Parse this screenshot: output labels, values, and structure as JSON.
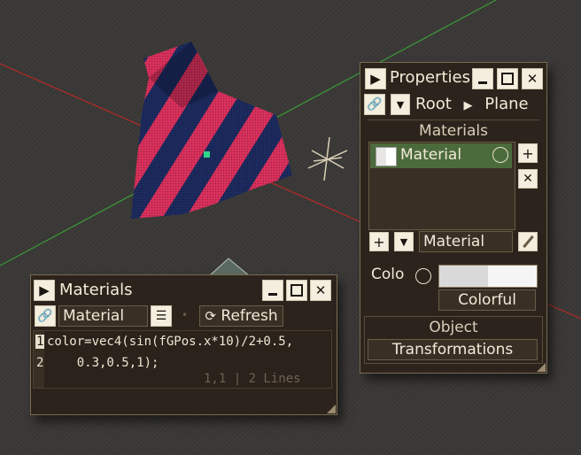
{
  "materials_window": {
    "title": "Materials",
    "material_name": "Material",
    "refresh_label": "Refresh",
    "code_lines": [
      {
        "num": "1",
        "text": "color=vec4(sin(fGPos.x*10)/2+0.5,"
      },
      {
        "num": "2",
        "text": "    0.3,0.5,1);"
      }
    ],
    "status": "1,1 | 2 Lines"
  },
  "properties_window": {
    "title": "Properties",
    "breadcrumb_root": "Root",
    "breadcrumb_child": "Plane",
    "materials_header": "Materials",
    "material_items": [
      "Material"
    ],
    "material_dropdown_value": "Material",
    "color_label": "Colo",
    "color_button_label": "Colorful",
    "object_header": "Object",
    "transformations_label": "Transformations"
  },
  "colors": {
    "panel_bg": "#2c241c",
    "panel_border": "#7a6a50",
    "selected_item": "#4b6b3c",
    "accent_axis_red": "#c0302a",
    "accent_axis_green": "#3ea03a"
  }
}
